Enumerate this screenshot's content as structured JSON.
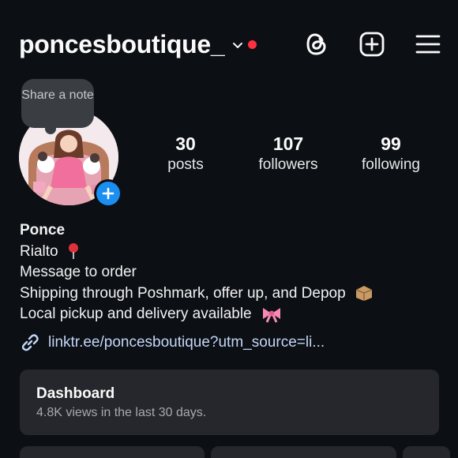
{
  "header": {
    "username": "poncesboutique_",
    "icons": [
      "chevron-down-icon",
      "notification-dot",
      "threads-icon",
      "create-post-icon",
      "menu-icon"
    ],
    "accent_red": "#ff3040"
  },
  "note": {
    "label": "Share a note"
  },
  "stats": [
    {
      "value": "30",
      "label": "posts"
    },
    {
      "value": "107",
      "label": "followers"
    },
    {
      "value": "99",
      "label": "following"
    }
  ],
  "bio": {
    "name": "Ponce",
    "line1": "Rialto",
    "line2": "Message to order",
    "line3": "Shipping through Poshmark, offer up, and Depop",
    "line4": "Local pickup and delivery available",
    "link": "linktr.ee/poncesboutique?utm_source=li...",
    "emojis": [
      "pin-icon",
      "package-icon",
      "bow-icon"
    ]
  },
  "dashboard": {
    "title": "Dashboard",
    "subtitle": "4.8K views in the last 30 days."
  },
  "colors": {
    "background": "#0c0f14",
    "card": "#25272c",
    "link": "#c3d7f7",
    "add_badge": "#1b8ef2"
  }
}
